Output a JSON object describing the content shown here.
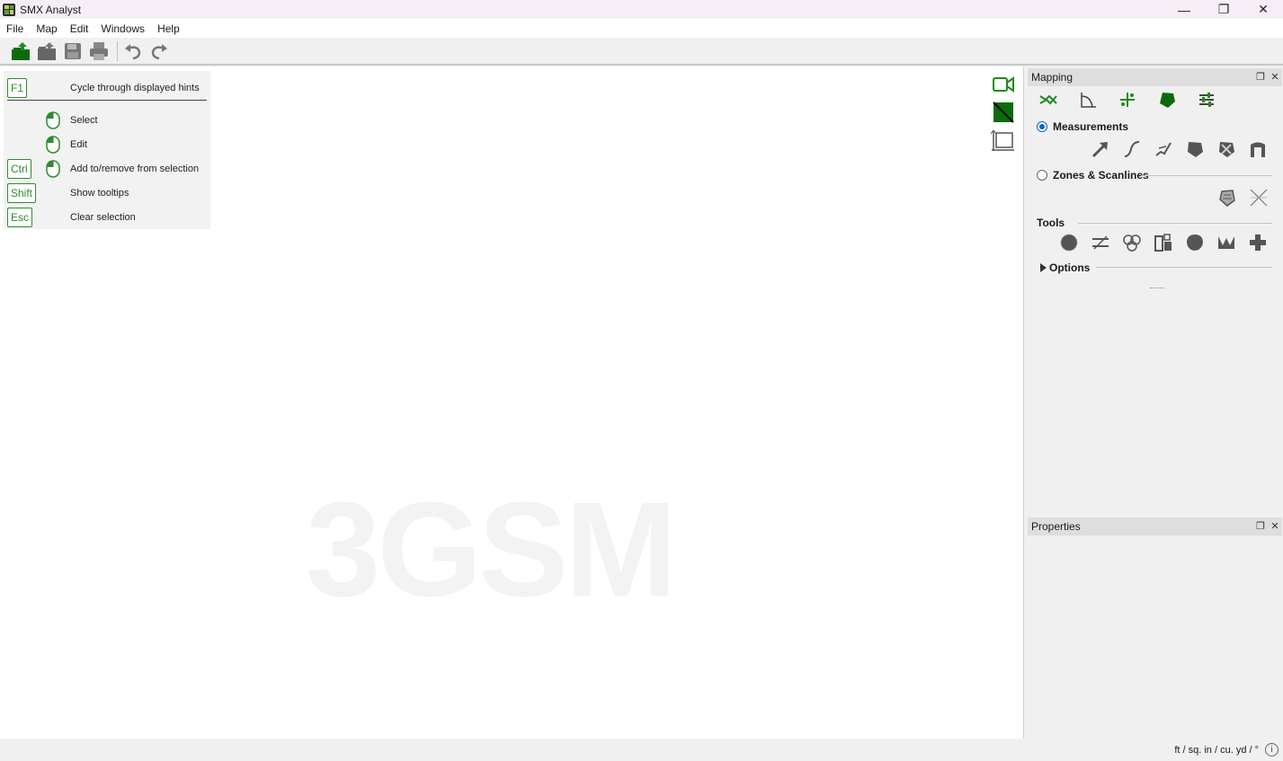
{
  "window": {
    "title": "SMX Analyst",
    "minimize": "—",
    "maximize": "❐",
    "close": "✕"
  },
  "menu": [
    "File",
    "Map",
    "Edit",
    "Windows",
    "Help"
  ],
  "toolbar": {
    "buttons": [
      "new-project-icon",
      "open-icon",
      "save-icon",
      "print-icon",
      "undo-icon",
      "redo-icon"
    ]
  },
  "hints": {
    "header": {
      "key": "F1",
      "label": "Cycle through displayed hints"
    },
    "rows": [
      {
        "key": "",
        "mouse": true,
        "label": "Select"
      },
      {
        "key": "",
        "mouse": true,
        "label": "Edit"
      },
      {
        "key": "Ctrl",
        "mouse": true,
        "label": "Add to/remove from selection"
      },
      {
        "key": "Shift",
        "mouse": false,
        "label": "Show tooltips"
      },
      {
        "key": "Esc",
        "mouse": false,
        "label": "Clear selection"
      }
    ]
  },
  "watermark": "3GSM",
  "mapping": {
    "title": "Mapping",
    "measurements": "Measurements",
    "zones": "Zones & Scanlines",
    "tools": "Tools",
    "options": "Options",
    "selected_mode": "Measurements"
  },
  "properties": {
    "title": "Properties"
  },
  "status": {
    "units": "ft / sq. in / cu. yd / °",
    "info": "i"
  },
  "colors": {
    "accent_green": "#1f8a1f",
    "dark_green": "#0b6b0b",
    "radio_blue": "#0a64c8"
  }
}
